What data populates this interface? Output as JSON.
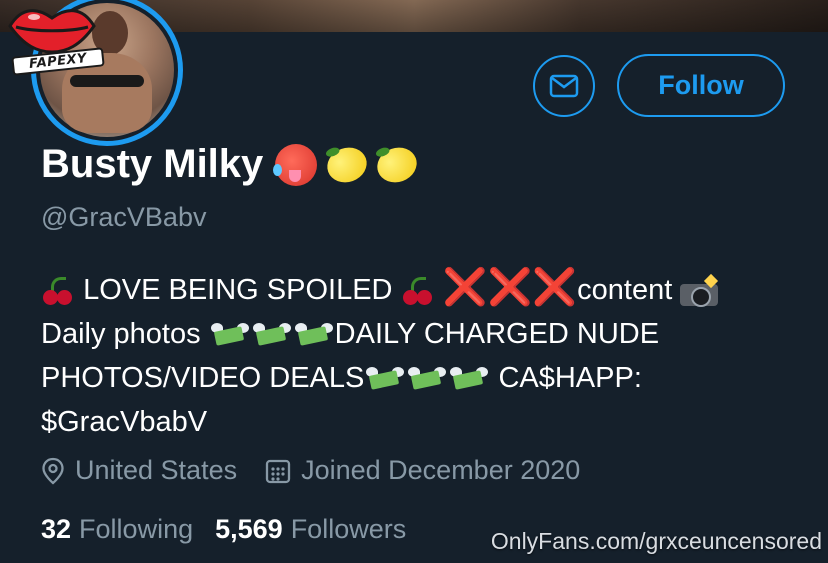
{
  "profile": {
    "name": "Busty Milky",
    "handle": "@GracVBabv",
    "name_emojis": [
      "hot-face-emoji",
      "lemon-emoji",
      "lemon-emoji"
    ]
  },
  "actions": {
    "message_icon": "envelope-icon",
    "follow_label": "Follow"
  },
  "logo": {
    "text": "FAPEXY"
  },
  "bio": {
    "line1_a": "LOVE BEING SPOILED",
    "xxx": "❌❌❌",
    "line1_b": "content",
    "line2_a": "Daily photos",
    "line2_b": "DAILY CHARGED NUDE",
    "line3_a": "PHOTOS/VIDEO DEALS",
    "line3_b": "CA$HAPP:",
    "line4": "$GracVbabV"
  },
  "meta": {
    "location": "United States",
    "joined": "Joined December 2020"
  },
  "stats": {
    "following_count": "32",
    "following_label": "Following",
    "followers_count": "5,569",
    "followers_label": "Followers"
  },
  "watermark": "OnlyFans.com/grxceuncensored",
  "colors": {
    "background": "#15202b",
    "accent": "#1d9bf0",
    "secondary_text": "#8899a6",
    "primary_text": "#ffffff"
  }
}
